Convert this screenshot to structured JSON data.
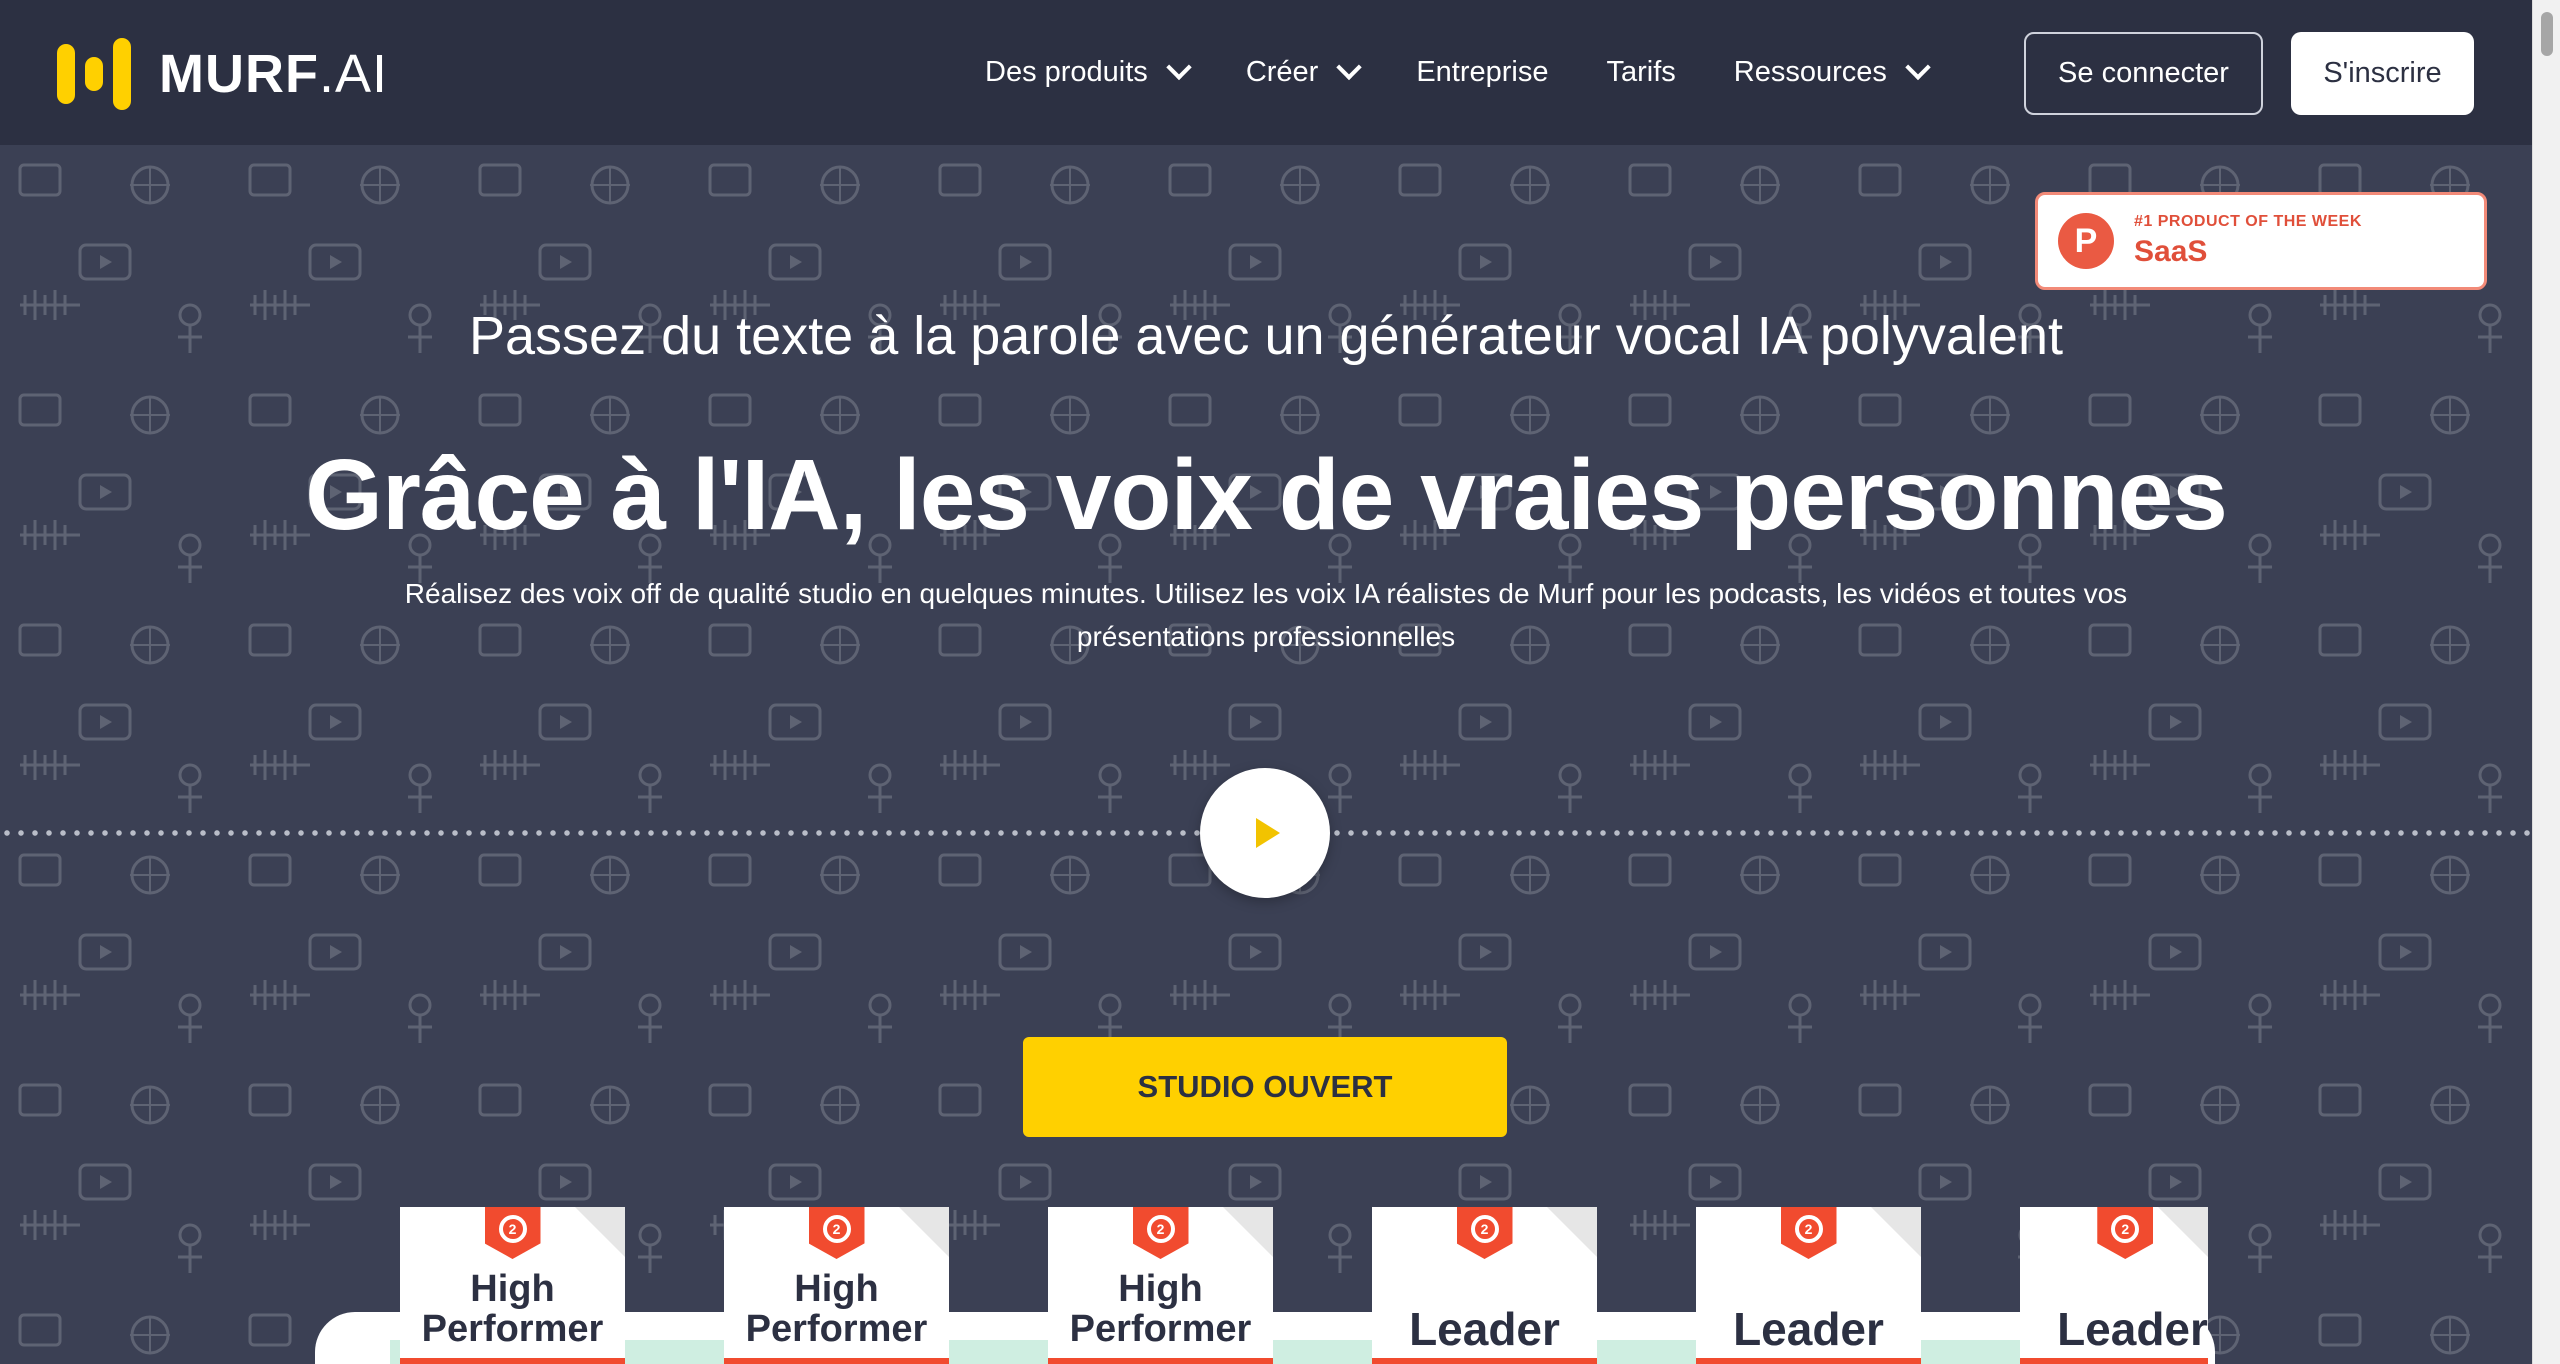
{
  "header": {
    "logo_text": "MURF",
    "logo_suffix": ".AI",
    "nav": [
      {
        "label": "Des produits",
        "has_dropdown": true
      },
      {
        "label": "Créer",
        "has_dropdown": true
      },
      {
        "label": "Entreprise",
        "has_dropdown": false
      },
      {
        "label": "Tarifs",
        "has_dropdown": false
      },
      {
        "label": "Ressources",
        "has_dropdown": true
      }
    ],
    "login_label": "Se connecter",
    "signup_label": "S'inscrire"
  },
  "product_hunt": {
    "small": "#1 PRODUCT OF THE WEEK",
    "big": "SaaS",
    "logo_letter": "P"
  },
  "hero": {
    "subtitle": "Passez du texte à la parole avec un générateur vocal IA polyvalent",
    "title": "Grâce à l'IA, les voix de vraies personnes",
    "description_line1": "Réalisez des voix off de qualité studio en quelques minutes. Utilisez les voix IA réalistes de Murf pour les podcasts, les vidéos et toutes vos",
    "description_line2": "présentations professionnelles",
    "cta_label": "STUDIO OUVERT"
  },
  "badges": [
    {
      "line1": "High",
      "line2": "Performer"
    },
    {
      "line1": "High",
      "line2": "Performer"
    },
    {
      "line1": "High",
      "line2": "Performer"
    },
    {
      "line1": "Leader",
      "line2": ""
    },
    {
      "line1": "Leader",
      "line2": ""
    },
    {
      "line1": "Leader",
      "line2": ""
    }
  ],
  "colors": {
    "accent": "#ffd000",
    "header_bg": "#2c3042",
    "hero_bg": "#3b4054",
    "g2_red": "#f14b2f"
  }
}
